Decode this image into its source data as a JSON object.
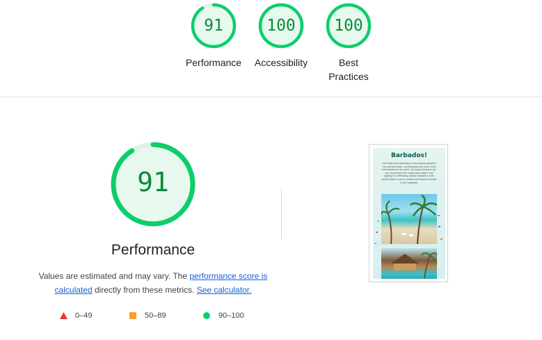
{
  "top_scores": [
    {
      "score": "91",
      "label_lines": [
        "Performance"
      ],
      "fraction": 0.91
    },
    {
      "score": "100",
      "label_lines": [
        "Accessibility"
      ],
      "fraction": 1.0
    },
    {
      "score": "100",
      "label_lines": [
        "Best",
        "Practices"
      ],
      "fraction": 1.0
    }
  ],
  "performance": {
    "score": "91",
    "fraction": 0.91,
    "title": "Performance",
    "desc_prefix": "Values are estimated and may vary. The ",
    "desc_link1": "performance score is calculated",
    "desc_middle": " directly from these metrics. ",
    "desc_link2": "See calculator."
  },
  "legend": [
    {
      "shape": "triangle",
      "range": "0–49",
      "color": "#e53935"
    },
    {
      "shape": "square",
      "range": "50–89",
      "color": "#fa9e2c"
    },
    {
      "shape": "circle",
      "range": "90–100",
      "color": "#0cce6b"
    }
  ],
  "screenshot": {
    "title": "Barbados!",
    "text": "Your ideal travel destination is the tropical paradise! You love the beach, and Barbados has some of the best beaches in the world. You enjoy relaxing in the sun, swimming in the crystal clear waters, and sipping on a refreshing cocktail. Barbados is the perfect place for you to unwind and enjoy the beauty of the Caribbean."
  },
  "colors": {
    "pass": "#0cce6b",
    "pass_text": "#0a8a3a",
    "pass_fill": "#e7f9ee",
    "link": "#1a5fd0"
  }
}
